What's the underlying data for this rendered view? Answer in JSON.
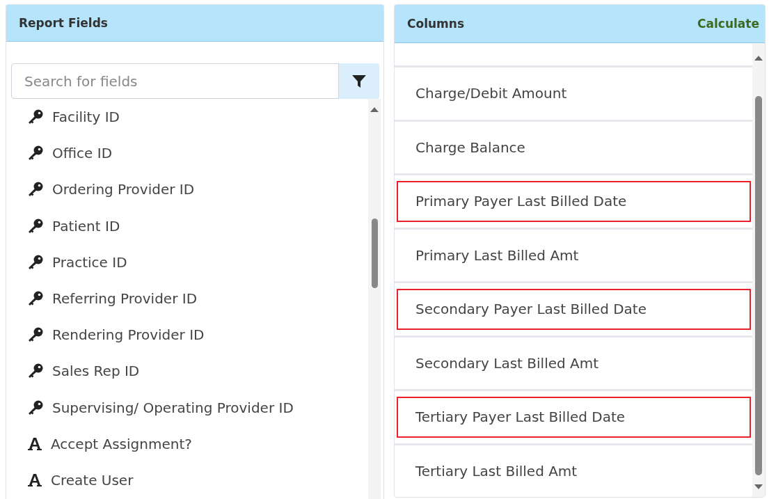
{
  "report_fields": {
    "title": "Report Fields",
    "search": {
      "placeholder": "Search for fields"
    },
    "items": [
      {
        "kind": "key",
        "label": "Facility ID"
      },
      {
        "kind": "key",
        "label": "Office ID"
      },
      {
        "kind": "key",
        "label": "Ordering Provider ID"
      },
      {
        "kind": "key",
        "label": "Patient ID"
      },
      {
        "kind": "key",
        "label": "Practice ID"
      },
      {
        "kind": "key",
        "label": "Referring Provider ID"
      },
      {
        "kind": "key",
        "label": "Rendering Provider ID"
      },
      {
        "kind": "key",
        "label": "Sales Rep ID"
      },
      {
        "kind": "key",
        "label": "Supervising/ Operating Provider ID"
      },
      {
        "kind": "text",
        "label": "Accept Assignment?"
      },
      {
        "kind": "text",
        "label": "Create User"
      }
    ]
  },
  "columns": {
    "title": "Columns",
    "action": "Calculate",
    "items": [
      {
        "label": "Charge/Debit Amount",
        "highlighted": false
      },
      {
        "label": "Charge Balance",
        "highlighted": false
      },
      {
        "label": "Primary Payer Last Billed Date",
        "highlighted": true
      },
      {
        "label": "Primary Last Billed Amt",
        "highlighted": false
      },
      {
        "label": "Secondary Payer Last Billed Date",
        "highlighted": true
      },
      {
        "label": "Secondary Last Billed Amt",
        "highlighted": false
      },
      {
        "label": "Tertiary Payer Last Billed Date",
        "highlighted": true
      },
      {
        "label": "Tertiary Last Billed Amt",
        "highlighted": false
      }
    ]
  }
}
